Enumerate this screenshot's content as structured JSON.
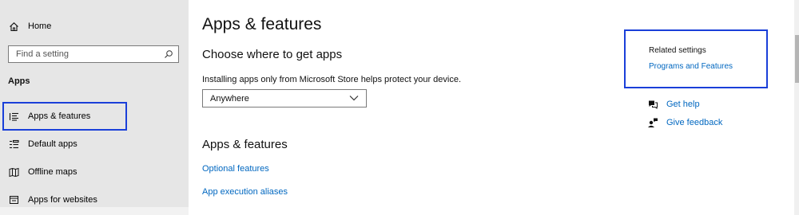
{
  "sidebar": {
    "home_label": "Home",
    "search_placeholder": "Find a setting",
    "section_label": "Apps",
    "items": [
      {
        "label": "Apps & features",
        "icon": "list-icon"
      },
      {
        "label": "Default apps",
        "icon": "default-apps-icon"
      },
      {
        "label": "Offline maps",
        "icon": "map-icon"
      },
      {
        "label": "Apps for websites",
        "icon": "apps-for-websites-icon"
      }
    ]
  },
  "main": {
    "title": "Apps & features",
    "choose_heading": "Choose where to get apps",
    "choose_description": "Installing apps only from Microsoft Store helps protect your device.",
    "source_dropdown_value": "Anywhere",
    "section_heading": "Apps & features",
    "links": [
      {
        "label": "Optional features"
      },
      {
        "label": "App execution aliases"
      }
    ]
  },
  "related": {
    "title": "Related settings",
    "link_label": "Programs and Features",
    "get_help_label": "Get help",
    "give_feedback_label": "Give feedback"
  },
  "colors": {
    "accent_link": "#0067c0",
    "focus_outline": "#1a3fd9",
    "sidebar_bg": "#e6e6e6"
  }
}
